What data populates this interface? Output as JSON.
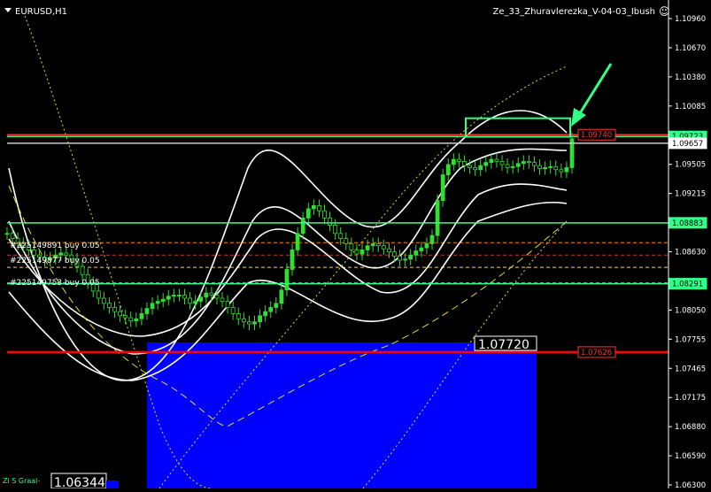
{
  "header": {
    "symbol_label": "EURUSD,H1",
    "indicator_label": "Ze_33_Zhuravlerezka_V-04-03_Ibush",
    "smiley": "☺"
  },
  "chart_data": {
    "type": "candlestick",
    "symbol": "EURUSD",
    "timeframe": "H1",
    "ylim": [
      1.063,
      1.1105
    ],
    "y_ticks": [
      "1.10960",
      "1.10670",
      "1.10380",
      "1.10085",
      "1.09795",
      "1.09505",
      "1.09215",
      "1.08920",
      "1.08630",
      "1.08340",
      "1.08050",
      "1.07755",
      "1.07465",
      "1.07175",
      "1.06880",
      "1.06590",
      "1.06300"
    ],
    "price_boxes": [
      {
        "label": "1.09723",
        "value": 1.09723,
        "style": "green-fill"
      },
      {
        "label": "1.09657",
        "value": 1.09657,
        "style": "white-fill"
      },
      {
        "label": "1.09740",
        "value": 1.0974,
        "style": "red-outline"
      },
      {
        "label": "1.08883",
        "value": 1.08883,
        "style": "green-fill"
      },
      {
        "label": "1.08291",
        "value": 1.08291,
        "style": "green-fill"
      },
      {
        "label": "1.07626",
        "value": 1.07626,
        "style": "red-outline"
      }
    ],
    "horizontal_lines": [
      {
        "value": 1.0974,
        "color": "#ff3333"
      },
      {
        "value": 1.09723,
        "color": "#33ff88"
      },
      {
        "value": 1.09657,
        "color": "#cccccc"
      },
      {
        "value": 1.08883,
        "color": "#33ff88"
      },
      {
        "value": 1.08291,
        "color": "#33ff88"
      },
      {
        "value": 1.07626,
        "color": "#ff0000"
      }
    ],
    "dotted_levels": [
      {
        "value": 1.0869,
        "color": "#ff8800"
      },
      {
        "value": 1.0857,
        "color": "#cc3333"
      },
      {
        "value": 1.0845,
        "color": "#ffcc66"
      },
      {
        "value": 1.083,
        "color": "#66cc66"
      }
    ],
    "orders": [
      {
        "label": "#225149891 buy 0.05"
      },
      {
        "label": "#225149877 buy 0.05"
      },
      {
        "label": "#225149753 buy 0.05"
      }
    ],
    "blue_zone": {
      "top": 1.0772,
      "bottom": 1.063
    },
    "blue_zone_label": "1.07720",
    "bottom_box_label": "1.06344",
    "bottom_indicator_label": "Zi S Graal-",
    "close_series": [
      1.0878,
      1.0873,
      1.0868,
      1.0866,
      1.0862,
      1.0857,
      1.0855,
      1.0852,
      1.0854,
      1.0857,
      1.0859,
      1.0857,
      1.0853,
      1.0846,
      1.0838,
      1.083,
      1.0822,
      1.0815,
      1.081,
      1.0806,
      1.0802,
      1.0798,
      1.0796,
      1.0793,
      1.0795,
      1.08,
      1.0805,
      1.081,
      1.0812,
      1.0814,
      1.0817,
      1.0818,
      1.0818,
      1.0815,
      1.081,
      1.0812,
      1.0816,
      1.082,
      1.0818,
      1.0815,
      1.0812,
      1.0806,
      1.08,
      1.0795,
      1.0792,
      1.079,
      1.0792,
      1.0798,
      1.0802,
      1.0806,
      1.081,
      1.0823,
      1.0843,
      1.0862,
      1.0878,
      1.0893,
      1.0902,
      1.0905,
      1.09,
      1.0893,
      1.0886,
      1.0878,
      1.0873,
      1.0868,
      1.0862,
      1.0858,
      1.0862,
      1.0866,
      1.0868,
      1.0866,
      1.0863,
      1.086,
      1.0856,
      1.0852,
      1.0853,
      1.0857,
      1.0861,
      1.0864,
      1.0868,
      1.0876,
      1.091,
      1.0935,
      1.0945,
      1.095,
      1.0948,
      1.0944,
      1.0942,
      1.094,
      1.0944,
      1.0947,
      1.095,
      1.0948,
      1.0945,
      1.0942,
      1.0943,
      1.0946,
      1.0948,
      1.0947,
      1.0944,
      1.0941,
      1.0942,
      1.0943,
      1.094,
      1.0938,
      1.0942,
      1.097
    ],
    "arrow_annotation": "green-arrow"
  }
}
